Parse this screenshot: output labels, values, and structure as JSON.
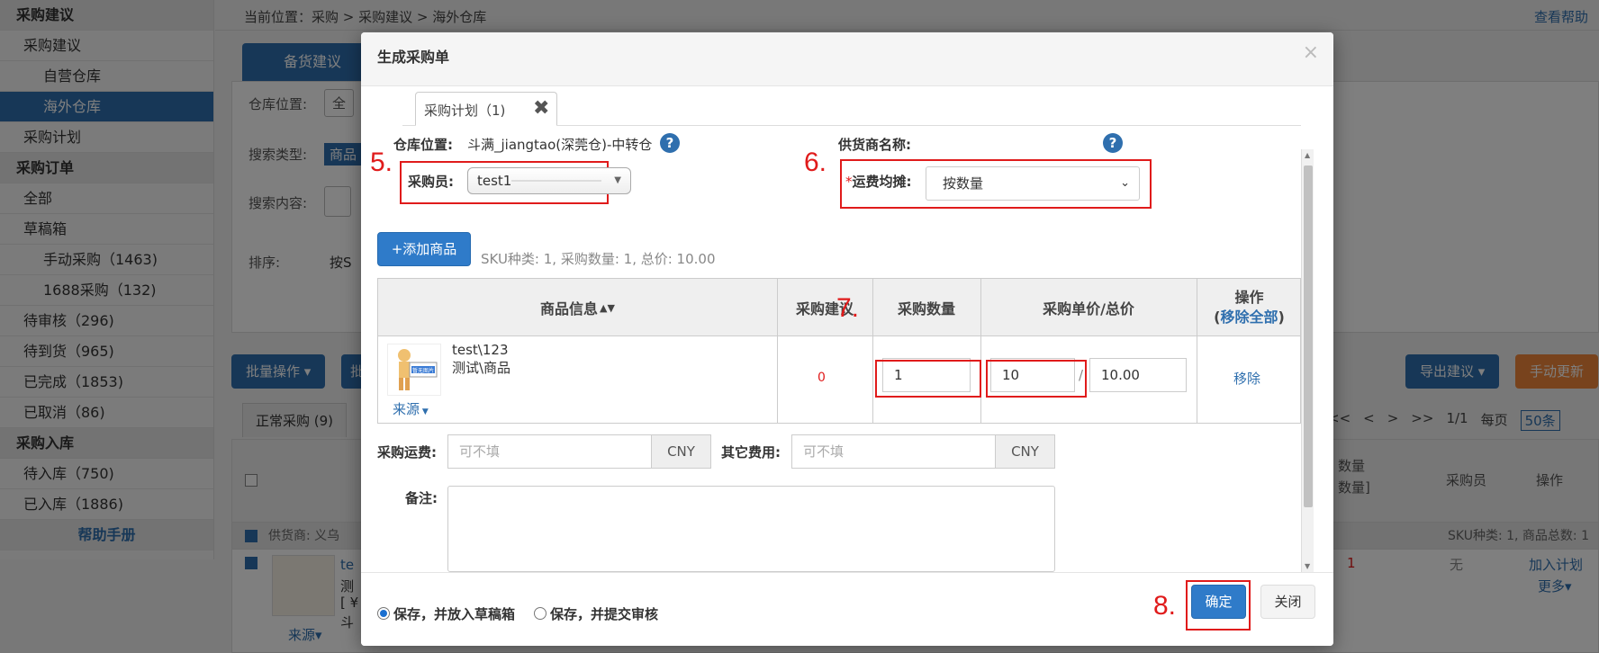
{
  "sidebar": {
    "items": [
      {
        "label": "采购建议",
        "type": "head"
      },
      {
        "label": "采购建议",
        "type": "l1"
      },
      {
        "label": "自营仓库",
        "type": "l2"
      },
      {
        "label": "海外仓库",
        "type": "l2-active"
      },
      {
        "label": "采购计划",
        "type": "l1"
      },
      {
        "label": "采购订单",
        "type": "head"
      },
      {
        "label": "全部",
        "type": "l1"
      },
      {
        "label": "草稿箱",
        "type": "l1"
      },
      {
        "label": "手动采购（1463)",
        "type": "l2"
      },
      {
        "label": "1688采购（132)",
        "type": "l2"
      },
      {
        "label": "待审核（296)",
        "type": "l1"
      },
      {
        "label": "待到货（965)",
        "type": "l1"
      },
      {
        "label": "已完成（1853)",
        "type": "l1"
      },
      {
        "label": "已取消（86)",
        "type": "l1"
      },
      {
        "label": "采购入库",
        "type": "head"
      },
      {
        "label": "待入库（750)",
        "type": "l1"
      },
      {
        "label": "已入库（1886)",
        "type": "l1"
      }
    ],
    "help_label": "帮助手册"
  },
  "page": {
    "breadcrumb": "当前位置：采购 > 采购建议 > 海外仓库",
    "help_link": "查看帮助",
    "tab_stock": "备货建议",
    "filter_warehouse": "仓库位置:",
    "filter_warehouse_value": "全",
    "filter_search_type": "搜索类型:",
    "filter_search_type_value": "商品",
    "filter_search_content": "搜索内容:",
    "filter_sort": "排序:",
    "filter_sort_value": "按S",
    "batch_btn": "批量操作 ▾",
    "batch_btn2": "批",
    "export_btn": "导出建议 ▾",
    "manual_update_btn": "手动更新",
    "list_tab": "正常采购 (9)",
    "pager": [
      "<<",
      "<",
      ">",
      ">>"
    ],
    "page_count": "1/1",
    "per_page_label": "每页",
    "per_page_value": "50条",
    "col_qty_partial": "数量",
    "col_qty_partial2": "数量]",
    "col_buyer": "采购员",
    "col_action": "操作",
    "supplier_prefix": "供货商: 义乌",
    "sku_summary": "SKU种类: 1, 商品总数: 1",
    "row_text1": "te",
    "row_text2": "测",
    "row_text3": "[ ¥",
    "row_text4": "斗",
    "row_source": "来源▾",
    "row_red": "1",
    "row_buyer": "无",
    "row_add_plan": "加入计划",
    "row_more": "更多▾"
  },
  "modal": {
    "title": "生成采购单",
    "close": "×",
    "tab_label": "采购计划（1)",
    "warehouse_label": "仓库位置:",
    "warehouse_value": "斗满_jiangtao(深莞仓)-中转仓",
    "supplier_label": "供货商名称:",
    "buyer_label": "采购员:",
    "buyer_value": "test1",
    "freight_required": "*",
    "freight_label": "运费均摊:",
    "freight_value": "按数量",
    "add_product_btn": "+添加商品",
    "sku_summary": "SKU种类: 1,  采购数量: 1,  总价: 10.00",
    "table": {
      "headers": [
        "商品信息",
        "采购建议",
        "采购数量",
        "采购单价/总价",
        "操作"
      ],
      "remove_all": "移除全部",
      "rows": [
        {
          "sku": "test\\123",
          "name": "测试\\商品",
          "source": "来源",
          "suggestion": "0",
          "qty": "1",
          "unit_price": "10",
          "total": "10.00",
          "remove": "移除",
          "no_image_label": "暂无图片"
        }
      ]
    },
    "freight_fee_label": "采购运费:",
    "freight_fee_placeholder": "可不填",
    "currency": "CNY",
    "other_fee_label": "其它费用:",
    "other_fee_placeholder": "可不填",
    "note_label": "备注:",
    "radio_draft": "保存，并放入草稿箱",
    "radio_submit": "保存，并提交审核",
    "confirm_btn": "确定",
    "close_btn": "关闭"
  },
  "annotations": {
    "step5": "5.",
    "step6": "6.",
    "step7": "7.",
    "step8": "8.",
    "color": "#e01b1b"
  }
}
